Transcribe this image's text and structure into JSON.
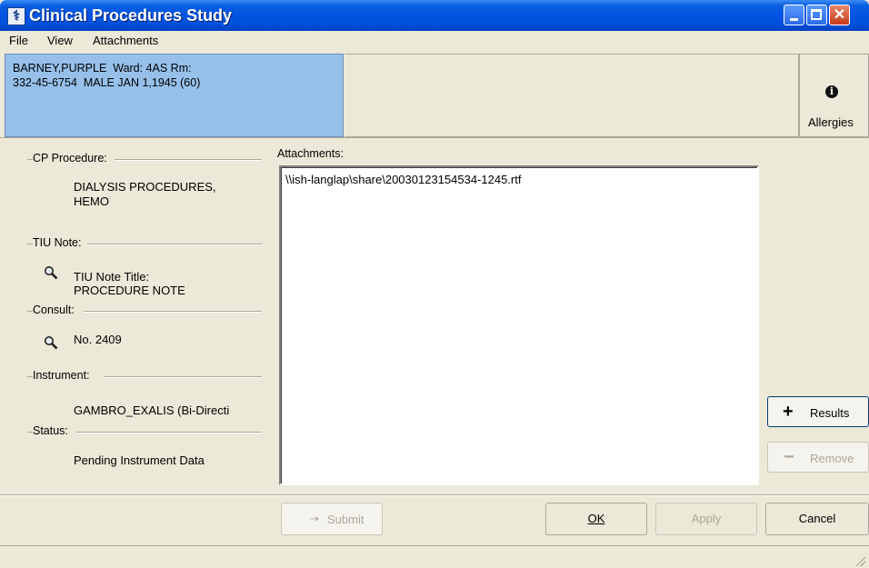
{
  "window": {
    "title": "Clinical Procedures Study",
    "controls": [
      "minimize-icon",
      "maximize-icon",
      "close-icon"
    ]
  },
  "menu": [
    "File",
    "View",
    "Attachments"
  ],
  "patient": {
    "line1": "BARNEY,PURPLE  Ward: 4AS Rm:",
    "line2": "332-45-6754  MALE JAN 1,1945 (60)",
    "allergies_label": "Allergies",
    "allergies_icon_glyph": "i"
  },
  "left": {
    "cp_procedure_label": "CP Procedure:",
    "cp_procedure_line1": "DIALYSIS PROCEDURES,",
    "cp_procedure_line2": "HEMO",
    "tiu_label": "TIU Note:",
    "tiu_title_label": "TIU Note Title:",
    "tiu_title_value": "PROCEDURE NOTE",
    "consult_label": "Consult:",
    "consult_value": "No. 2409",
    "instrument_label": "Instrument:",
    "instrument_value": "GAMBRO_EXALIS (Bi-Directi",
    "status_label": "Status:",
    "status_value": "Pending Instrument Data"
  },
  "attachments": {
    "label": "Attachments:",
    "items": [
      "\\\\ish-langlap\\share\\20030123154534-1245.rtf"
    ]
  },
  "side_buttons": {
    "results": "Results",
    "remove": "Remove"
  },
  "footer_buttons": {
    "submit": "Submit",
    "ok": "OK",
    "apply": "Apply",
    "cancel": "Cancel"
  },
  "colors": {
    "titlebar": "#0054e3",
    "patient_bg": "#96c0ea",
    "dialog_bg": "#ece9d8"
  }
}
